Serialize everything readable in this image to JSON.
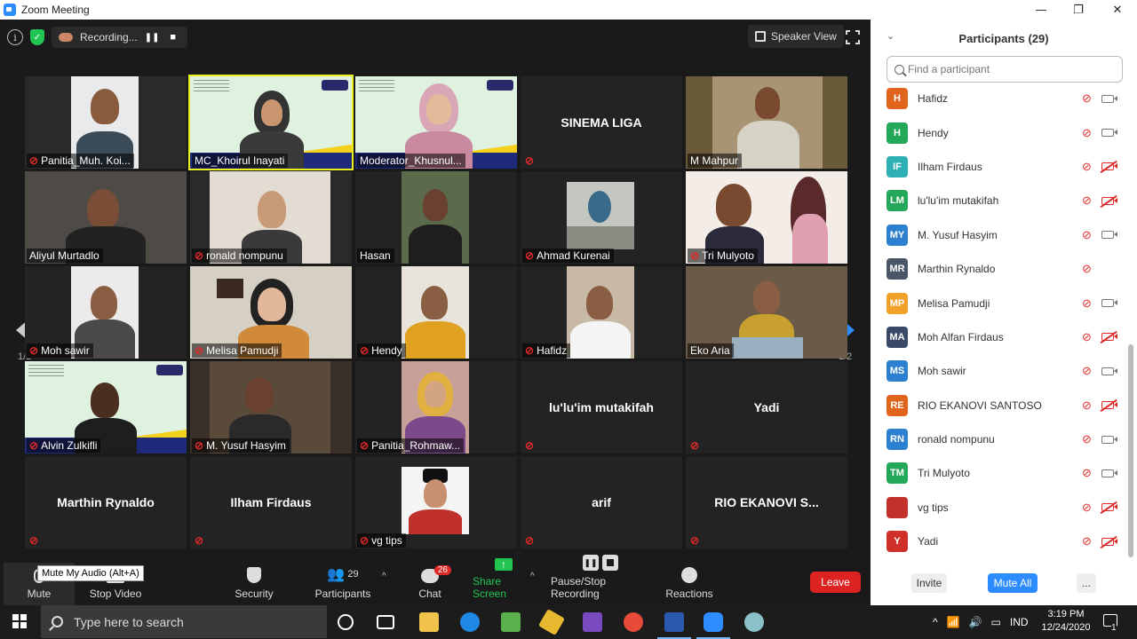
{
  "window": {
    "title": "Zoom Meeting",
    "minimize": "—",
    "maximize": "❐",
    "close": "✕"
  },
  "meeting_top": {
    "recording_label": "Recording...",
    "speaker_view_label": "Speaker View"
  },
  "tiles": [
    {
      "name": "Panitia_Muh. Koi...",
      "muted": true
    },
    {
      "name": "MC_Khoirul Inayati",
      "muted": false
    },
    {
      "name": "Moderator_Khusnul...",
      "muted": false
    },
    {
      "name": "SINEMA LIGA",
      "muted": true
    },
    {
      "name": "M Mahpur",
      "muted": false
    },
    {
      "name": "Aliyul Murtadlo",
      "muted": false
    },
    {
      "name": "ronald nompunu",
      "muted": true
    },
    {
      "name": "Hasan",
      "muted": false
    },
    {
      "name": "Ahmad Kurenai",
      "muted": true
    },
    {
      "name": "Tri Mulyoto",
      "muted": true
    },
    {
      "name": "Moh sawir",
      "muted": true
    },
    {
      "name": "Melisa Pamudji",
      "muted": true
    },
    {
      "name": "Hendy",
      "muted": true
    },
    {
      "name": "Hafidz",
      "muted": true
    },
    {
      "name": "Eko Aria",
      "muted": false
    },
    {
      "name": "Alvin Zulkifli",
      "muted": true
    },
    {
      "name": "M. Yusuf Hasyim",
      "muted": true
    },
    {
      "name": "Panitia_Rohmaw...",
      "muted": true
    },
    {
      "name": "lu'lu'im mutakifah",
      "muted": true
    },
    {
      "name": "Yadi",
      "muted": true
    },
    {
      "name": "Marthin Rynaldo",
      "muted": true
    },
    {
      "name": "Ilham Firdaus",
      "muted": true
    },
    {
      "name": "vg tips",
      "muted": true
    },
    {
      "name": "arif",
      "muted": true
    },
    {
      "name": "RIO EKANOVI S...",
      "muted": true
    }
  ],
  "pager": {
    "left": "1/2",
    "right": "1/2"
  },
  "toolbar": {
    "mute": "Mute",
    "mute_tooltip": "Mute My Audio (Alt+A)",
    "stop_video": "Stop Video",
    "security": "Security",
    "participants": "Participants",
    "participants_count": "29",
    "chat": "Chat",
    "chat_badge": "26",
    "share_screen": "Share Screen",
    "pause_stop_recording": "Pause/Stop Recording",
    "reactions": "Reactions",
    "leave": "Leave"
  },
  "panel": {
    "title": "Participants (29)",
    "search_placeholder": "Find a participant",
    "participants": [
      {
        "initials": "H",
        "name": "Hafidz",
        "color": "#e0641c",
        "video_off": false
      },
      {
        "initials": "H",
        "name": "Hendy",
        "color": "#23a85a",
        "video_off": false
      },
      {
        "initials": "IF",
        "name": "Ilham Firdaus",
        "color": "#2eafb3",
        "video_off": true
      },
      {
        "initials": "LM",
        "name": "lu'lu'im mutakifah",
        "color": "#23a85a",
        "video_off": true
      },
      {
        "initials": "MY",
        "name": "M. Yusuf Hasyim",
        "color": "#2d7fd0",
        "video_off": false
      },
      {
        "initials": "MR",
        "name": "Marthin Rynaldo",
        "color": "#4a5566",
        "video_off": null
      },
      {
        "initials": "MP",
        "name": "Melisa Pamudji",
        "color": "#f2a02a",
        "video_off": false
      },
      {
        "initials": "MA",
        "name": "Moh Alfan Firdaus",
        "color": "#3a4a66",
        "video_off": true
      },
      {
        "initials": "MS",
        "name": "Moh sawir",
        "color": "#2d7fd0",
        "video_off": false
      },
      {
        "initials": "RE",
        "name": "RIO EKANOVI SANTOSO",
        "color": "#e0641c",
        "video_off": true
      },
      {
        "initials": "RN",
        "name": "ronald nompunu",
        "color": "#2d7fd0",
        "video_off": false
      },
      {
        "initials": "TM",
        "name": "Tri Mulyoto",
        "color": "#23a85a",
        "video_off": false
      },
      {
        "initials": "",
        "name": "vg tips",
        "color": "#c0322a",
        "video_off": true
      },
      {
        "initials": "Y",
        "name": "Yadi",
        "color": "#d0302a",
        "video_off": true
      }
    ],
    "invite": "Invite",
    "mute_all": "Mute All",
    "more": "..."
  },
  "taskbar": {
    "search_placeholder": "Type here to search",
    "language": "IND",
    "time": "3:19 PM",
    "date": "12/24/2020",
    "notification_count": "1"
  }
}
